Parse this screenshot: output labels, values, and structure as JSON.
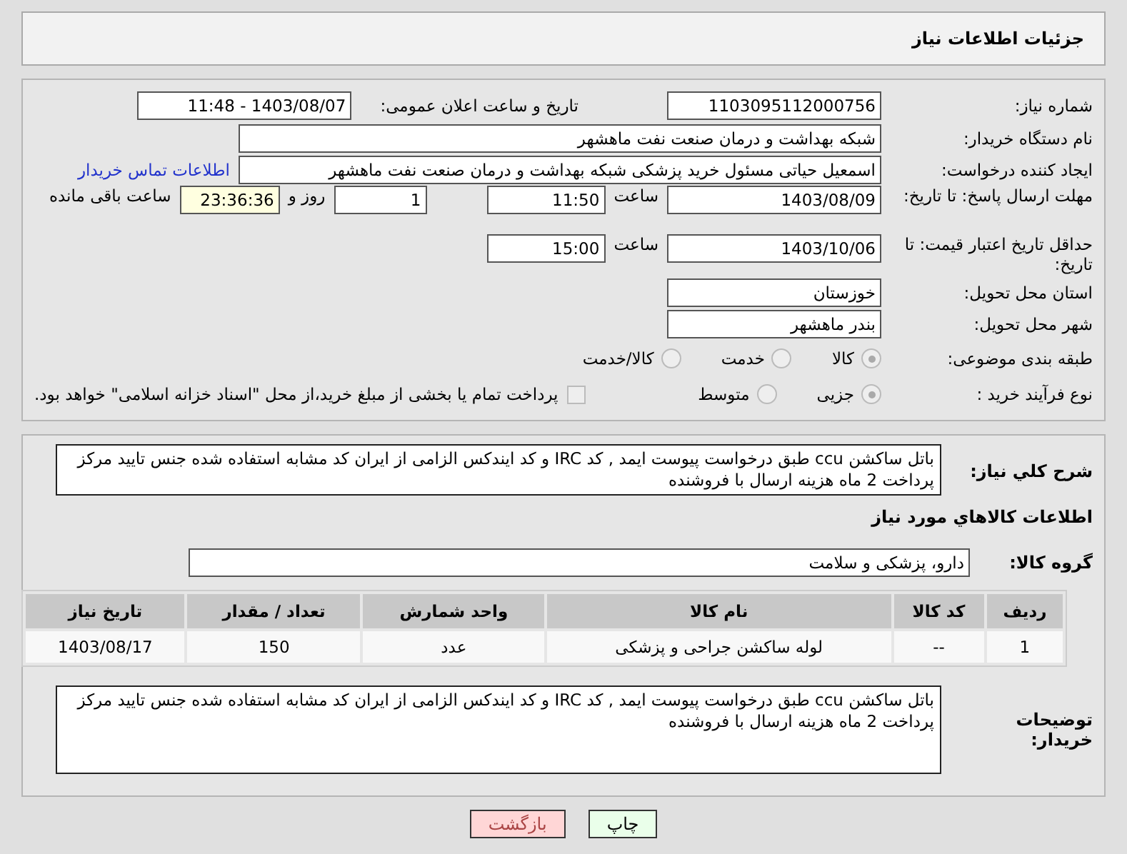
{
  "header": {
    "title": "جزئیات اطلاعات نیاز"
  },
  "need_number": {
    "label": "شماره نیاز:",
    "value": "1103095112000756"
  },
  "announce": {
    "label": "تاریخ و ساعت اعلان عمومی:",
    "value": "1403/08/07 - 11:48"
  },
  "buyer_org": {
    "label": "نام دستگاه خریدار:",
    "value": "شبکه بهداشت و درمان صنعت نفت ماهشهر"
  },
  "requester": {
    "label": "ایجاد کننده درخواست:",
    "value": "اسمعیل حیاتی مسئول خرید پزشکی شبکه بهداشت و درمان صنعت نفت ماهشهر",
    "link": "اطلاعات تماس خریدار"
  },
  "reply_deadline": {
    "label": "مهلت ارسال پاسخ: تا تاریخ:",
    "date": "1403/08/09",
    "time_label": "ساعت",
    "time": "11:50",
    "days": "1",
    "days_label": "روز و",
    "remaining": "23:36:36",
    "remaining_label": "ساعت باقی مانده"
  },
  "price_validity": {
    "label": "حداقل تاریخ اعتبار قیمت: تا تاریخ:",
    "date": "1403/10/06",
    "time_label": "ساعت",
    "time": "15:00"
  },
  "province": {
    "label": "استان محل تحویل:",
    "value": "خوزستان"
  },
  "city": {
    "label": "شهر محل تحویل:",
    "value": "بندر ماهشهر"
  },
  "category": {
    "label": "طبقه بندی موضوعی:",
    "options": [
      {
        "label": "کالا",
        "selected": true
      },
      {
        "label": "خدمت",
        "selected": false
      },
      {
        "label": "کالا/خدمت",
        "selected": false
      }
    ]
  },
  "purchase_type": {
    "label": "نوع فرآیند خرید :",
    "options": [
      {
        "label": "جزیی",
        "selected": true
      },
      {
        "label": "متوسط",
        "selected": false
      }
    ],
    "payment_checkbox": {
      "checked": false,
      "label": "پرداخت تمام یا بخشی از مبلغ خرید،از محل \"اسناد خزانه اسلامی\" خواهد بود."
    }
  },
  "description": {
    "label": "شرح کلي نياز:",
    "value": "باتل ساکشن ccu طبق درخواست پیوست ایمد , کد IRC و کد ایندکس الزامی از ایران کد مشابه استفاده شده جنس تایید مرکز پرداخت 2 ماه هزینه ارسال با فروشنده"
  },
  "goods_section": {
    "title": "اطلاعات كالاهاي مورد نياز",
    "group_label": "گروه کالا:",
    "group_value": "دارو، پزشکی و سلامت"
  },
  "table": {
    "columns": [
      "ردیف",
      "کد کالا",
      "نام کالا",
      "واحد شمارش",
      "تعداد / مقدار",
      "تاریخ نیاز"
    ],
    "rows": [
      [
        "1",
        "--",
        "لوله ساکشن جراحی و پزشکی",
        "عدد",
        "150",
        "1403/08/17"
      ]
    ]
  },
  "buyer_notes": {
    "label": "توضیحات خریدار:",
    "value": "باتل ساکشن ccu طبق درخواست پیوست ایمد , کد IRC و کد ایندکس الزامی از ایران کد مشابه استفاده شده جنس تایید مرکز پرداخت 2 ماه هزینه ارسال با فروشنده"
  },
  "buttons": [
    {
      "label": "چاپ",
      "kind": "print"
    },
    {
      "label": "بازگشت",
      "kind": "back"
    }
  ]
}
